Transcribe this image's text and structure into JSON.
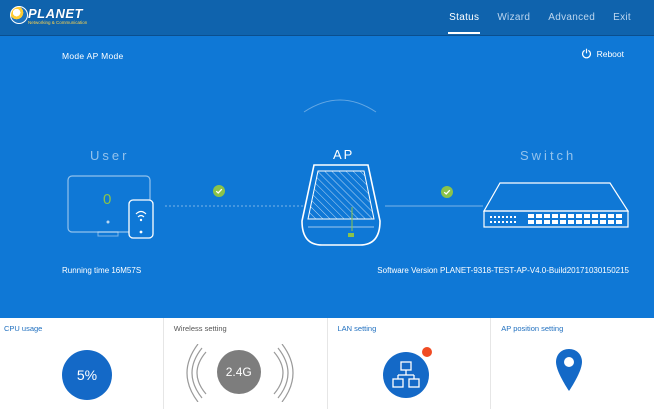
{
  "header": {
    "logo_text": "PLANET",
    "logo_tagline": "Networking & Communication",
    "nav": [
      {
        "label": "Status",
        "active": true
      },
      {
        "label": "Wizard",
        "active": false
      },
      {
        "label": "Advanced",
        "active": false
      },
      {
        "label": "Exit",
        "active": false
      }
    ]
  },
  "status": {
    "mode": "Mode  AP Mode",
    "reboot_label": "Reboot",
    "nodes": {
      "user": "User",
      "ap": "AP",
      "switch": "Switch"
    },
    "user_count": "0",
    "running_time": "Running time  16M57S",
    "software_version": "Software Version   PLANET-9318-TEST-AP-V4.0-Build20171030150215"
  },
  "cards": [
    {
      "title": "CPU usage",
      "value": "5%"
    },
    {
      "title": "Wireless setting",
      "value": "2.4G"
    },
    {
      "title": "LAN setting"
    },
    {
      "title": "AP position setting"
    }
  ],
  "colors": {
    "header_bg": "#0f63ad",
    "hero_bg": "#0f78d6",
    "accent_blue": "#1469c7",
    "link_ok_green": "#8bc34a",
    "alert_red": "#f04b23"
  }
}
